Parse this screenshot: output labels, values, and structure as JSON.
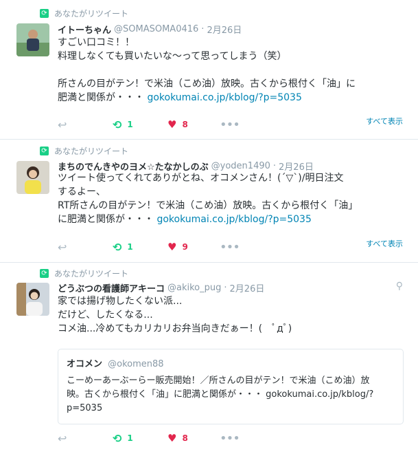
{
  "tweets": [
    {
      "rt_label": "あなたがリツイート",
      "name": "イトーちゃん",
      "handle": "@SOMASOMA0416",
      "dot": "·",
      "date": "2月26日",
      "lines": [
        "すごい口コミ！！",
        "料理しなくても買いたいな〜って思ってしまう（笑）",
        "",
        "所さんの目がテン！で米油（こめ油）放映。古くから根付く「油」に"
      ],
      "last_line_text": "肥満と関係が・・・",
      "link": "gokokumai.co.jp/kblog/?p=5035",
      "retweets": "1",
      "likes": "8",
      "show_all": "すべて表示"
    },
    {
      "rt_label": "あなたがリツイート",
      "name": "まちのでんきやのヨメ☆たなかしのぶ",
      "handle": "@yoden1490",
      "dot": "·",
      "date": "2月26日",
      "lines": [
        "ツイート使ってくれてありがとね、オコメンさん！(´▽`)/明日注文",
        "するよー、",
        "RT所さんの目がテン！で米油（こめ油）放映。古くから根付く「油」"
      ],
      "last_line_text": "に肥満と関係が・・・",
      "link": "gokokumai.co.jp/kblog/?p=5035",
      "retweets": "1",
      "likes": "9",
      "show_all": "すべて表示"
    },
    {
      "rt_label": "あなたがリツイート",
      "name": "どうぶつの看護師アキーコ",
      "handle": "@akiko_pug",
      "dot": "·",
      "date": "2月26日",
      "lines": [
        "家では揚げ物したくない派...",
        "だけど、したくなる...",
        "コメ油...冷めてもカリカリお弁当向きだぁー！(　ﾟдﾟ)"
      ],
      "quote": {
        "name": "オコメン",
        "handle": "@okomen88",
        "lines": [
          "こーめーあーぶーらー販売開始！／所さんの目がテン！で米油（こめ油）放",
          "映。古くから根付く「油」に肥満と関係が・・・ gokokumai.co.jp/kblog/?",
          "p=5035"
        ]
      },
      "retweets": "1",
      "likes": "8"
    }
  ],
  "icons": {
    "retweet_banner": "retweet-icon",
    "reply": "reply-icon",
    "retweet": "retweet-icon",
    "like": "heart-icon",
    "more": "more-icon",
    "location": "location-pin-icon"
  },
  "colors": {
    "retweet_green": "#19cf86",
    "like_red": "#e2264d",
    "link_blue": "#0084b4",
    "muted_gray": "#8899a6"
  }
}
